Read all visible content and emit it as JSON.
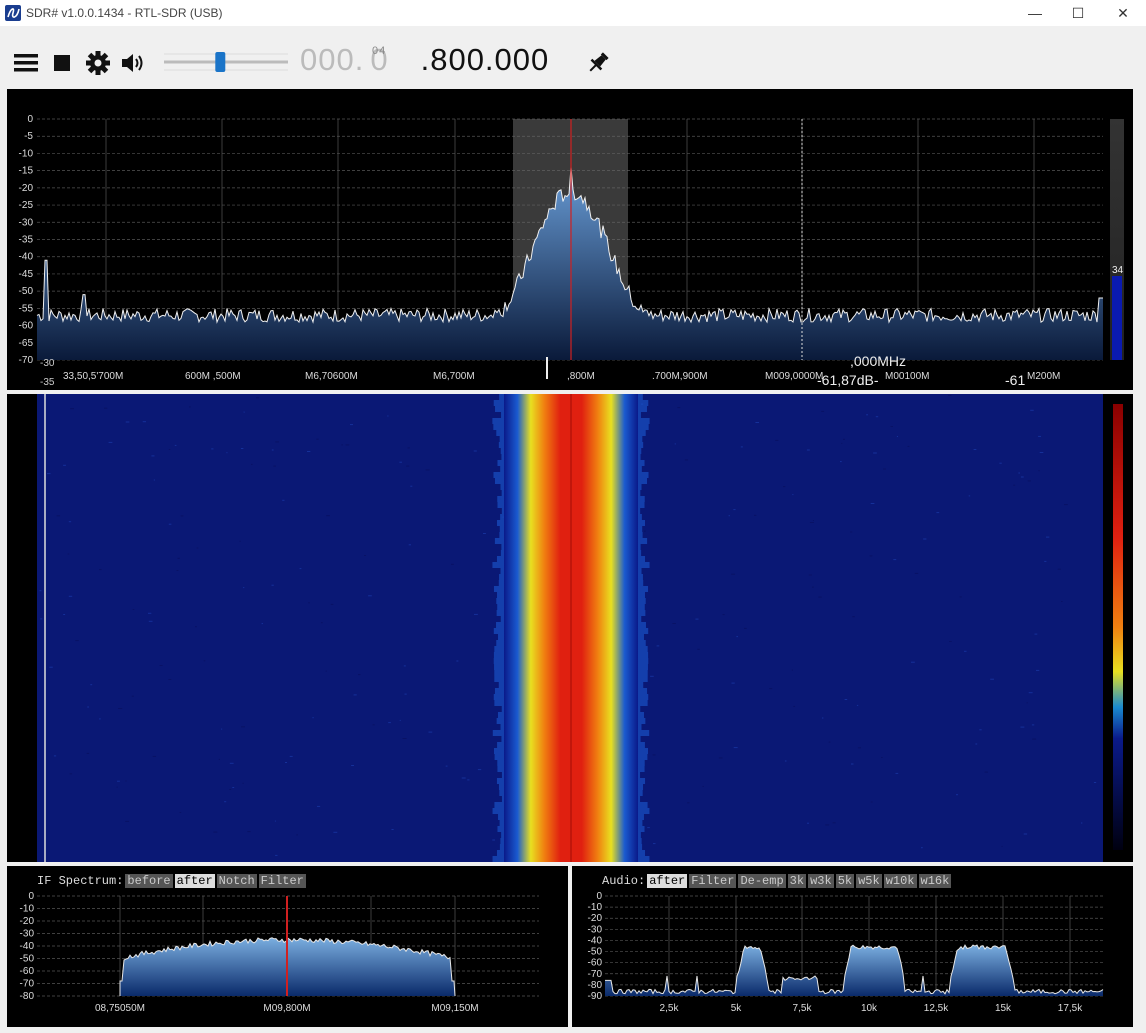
{
  "window": {
    "title": "SDR# v1.0.0.1434 - RTL-SDR (USB)",
    "minimize": "—",
    "maximize": "☐",
    "close": "✕"
  },
  "toolbar": {
    "menu_icon": "menu-icon",
    "stop_icon": "stop-icon",
    "settings_icon": "gear-icon",
    "audio_icon": "speaker-icon",
    "volume_level": 0.45,
    "frequency_dim": "000.",
    "frequency_overlay_1": "0",
    "frequency_overlay_2": "04",
    "frequency_main": ".800.000",
    "pin_icon": "pin-icon"
  },
  "spectrum": {
    "y_ticks": [
      "0",
      "-5",
      "-10",
      "-15",
      "-20",
      "-25",
      "-30",
      "-35",
      "-40",
      "-45",
      "-50",
      "-55",
      "-60",
      "-65",
      "-70"
    ],
    "y_ticks_extra": [
      "-30",
      "-35"
    ],
    "x_labels": [
      "33,50,5'700M",
      "600M ,500M",
      "M6,70600M",
      "M6,700M",
      ",800M",
      ".700M,900M",
      "M009,0000M",
      "M00100M",
      "M200M"
    ],
    "cursor_freq": ",000MHz",
    "cursor_level": "-61,87dB-",
    "cursor_level_right": "-61",
    "gain_value": "34"
  },
  "if_panel": {
    "title": "IF Spectrum:",
    "buttons": [
      {
        "label": "before",
        "active": false
      },
      {
        "label": "after",
        "active": true
      },
      {
        "label": "Notch",
        "active": false
      },
      {
        "label": "Filter",
        "active": false
      }
    ],
    "y_ticks": [
      "0",
      "-10",
      "-20",
      "-30",
      "-40",
      "-50",
      "-60",
      "-70",
      "-80"
    ],
    "x_labels": [
      "08,75050M",
      "M09,800M",
      "M09,150M"
    ]
  },
  "audio_panel": {
    "title": "Audio:",
    "buttons": [
      {
        "label": "after",
        "active": true
      },
      {
        "label": "Filter",
        "active": false
      },
      {
        "label": "De-emp",
        "active": false
      },
      {
        "label": "3k",
        "active": false
      },
      {
        "label": "w3k",
        "active": false
      },
      {
        "label": "5k",
        "active": false
      },
      {
        "label": "w5k",
        "active": false
      },
      {
        "label": "w10k",
        "active": false
      },
      {
        "label": "w16k",
        "active": false
      }
    ],
    "y_ticks": [
      "0",
      "-10",
      "-20",
      "-30",
      "-40",
      "-50",
      "-60",
      "-70",
      "-80",
      "-90"
    ],
    "x_labels": [
      "2,5k",
      "5k",
      "7,5k",
      "10k",
      "12,5k",
      "15k",
      "17,5k"
    ]
  },
  "colors": {
    "spectrum_fill_top": "#5a8fd0",
    "spectrum_fill_bottom": "#0a1a3a",
    "center_marker": "#d02020",
    "waterfall_bg": "#0a1670",
    "waterfall_hot": "#e02010"
  }
}
